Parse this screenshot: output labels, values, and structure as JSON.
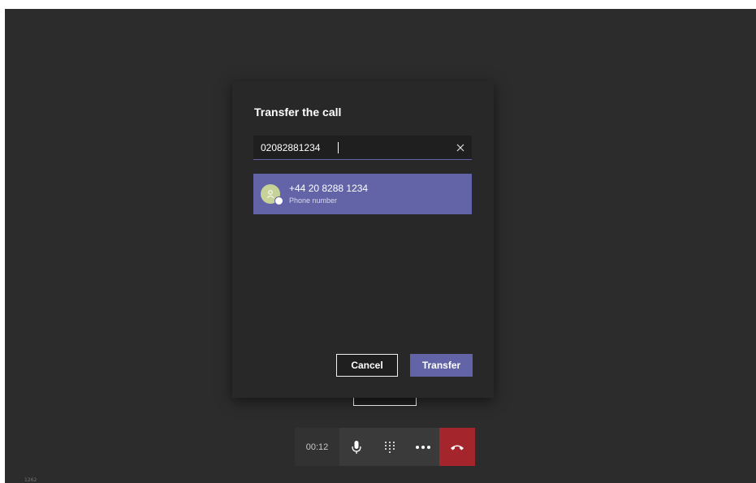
{
  "dialog": {
    "title": "Transfer the call",
    "search_value": "02082881234",
    "result": {
      "name": "+44 20 8288 1234",
      "subtitle": "Phone number"
    },
    "cancel_label": "Cancel",
    "transfer_label": "Transfer"
  },
  "call_controls": {
    "timer": "00:12",
    "icons": [
      "microphone-icon",
      "dialpad-icon",
      "more-options-icon",
      "hang-up-icon"
    ]
  },
  "colors": {
    "accent": "#6264a7",
    "hangup": "#a4262c",
    "background": "#2d2c2c",
    "dialog": "#292828"
  }
}
